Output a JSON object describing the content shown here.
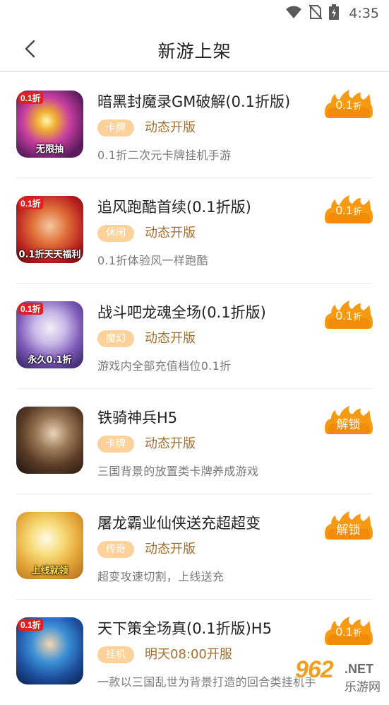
{
  "status_bar": {
    "time": "4:35",
    "icons": [
      "wifi-icon",
      "no-sim-icon",
      "battery-charging-icon"
    ]
  },
  "header": {
    "title": "新游上架",
    "back_icon": "chevron-left-icon"
  },
  "colors": {
    "badge_orange": "#f59a12",
    "tag_bg": "#fcd19a",
    "open_text": "#a07030",
    "desc_text": "#7a7a7a"
  },
  "games": [
    {
      "name": "暗黑封魔录GM破解(0.1折版)",
      "tag": "卡牌",
      "open": "动态开版",
      "desc": "0.1折二次元卡牌挂机手游",
      "badge": "0.1",
      "badge_unit": "折",
      "thumb_stamp": "0.1折",
      "thumb_band": "无限抽"
    },
    {
      "name": "追风跑酷首续(0.1折版)",
      "tag": "休闲",
      "open": "动态开版",
      "desc": "0.1折体验风一样跑酷",
      "badge": "0.1",
      "badge_unit": "折",
      "thumb_stamp": "0.1折",
      "thumb_band": "0.1折天天福利"
    },
    {
      "name": "战斗吧龙魂全场(0.1折版)",
      "tag": "魔幻",
      "open": "动态开版",
      "desc": "游戏内全部充值档位0.1折",
      "badge": "0.1",
      "badge_unit": "折",
      "thumb_stamp": "0.1折",
      "thumb_band": "永久0.1折"
    },
    {
      "name": "铁骑神兵H5",
      "tag": "卡牌",
      "open": "动态开版",
      "desc": "三国背景的放置类卡牌养成游戏",
      "badge": "解锁",
      "badge_unit": "",
      "thumb_stamp": "",
      "thumb_band": ""
    },
    {
      "name": "屠龙霸业仙侠送充超超变",
      "tag": "传奇",
      "open": "动态开版",
      "desc": "超变攻速切割，上线送充",
      "badge": "解锁",
      "badge_unit": "",
      "thumb_stamp": "",
      "thumb_band": "上线就领"
    },
    {
      "name": "天下策全场真(0.1折版)H5",
      "tag": "挂机",
      "open": "明天08:00开服",
      "desc": "一款以三国乱世为背景打造的回合类挂机手",
      "badge": "0.1",
      "badge_unit": "折",
      "thumb_stamp": "0.1折",
      "thumb_band": ""
    }
  ],
  "watermark": {
    "number": "962",
    "net": ".NET",
    "site": "乐游网"
  }
}
